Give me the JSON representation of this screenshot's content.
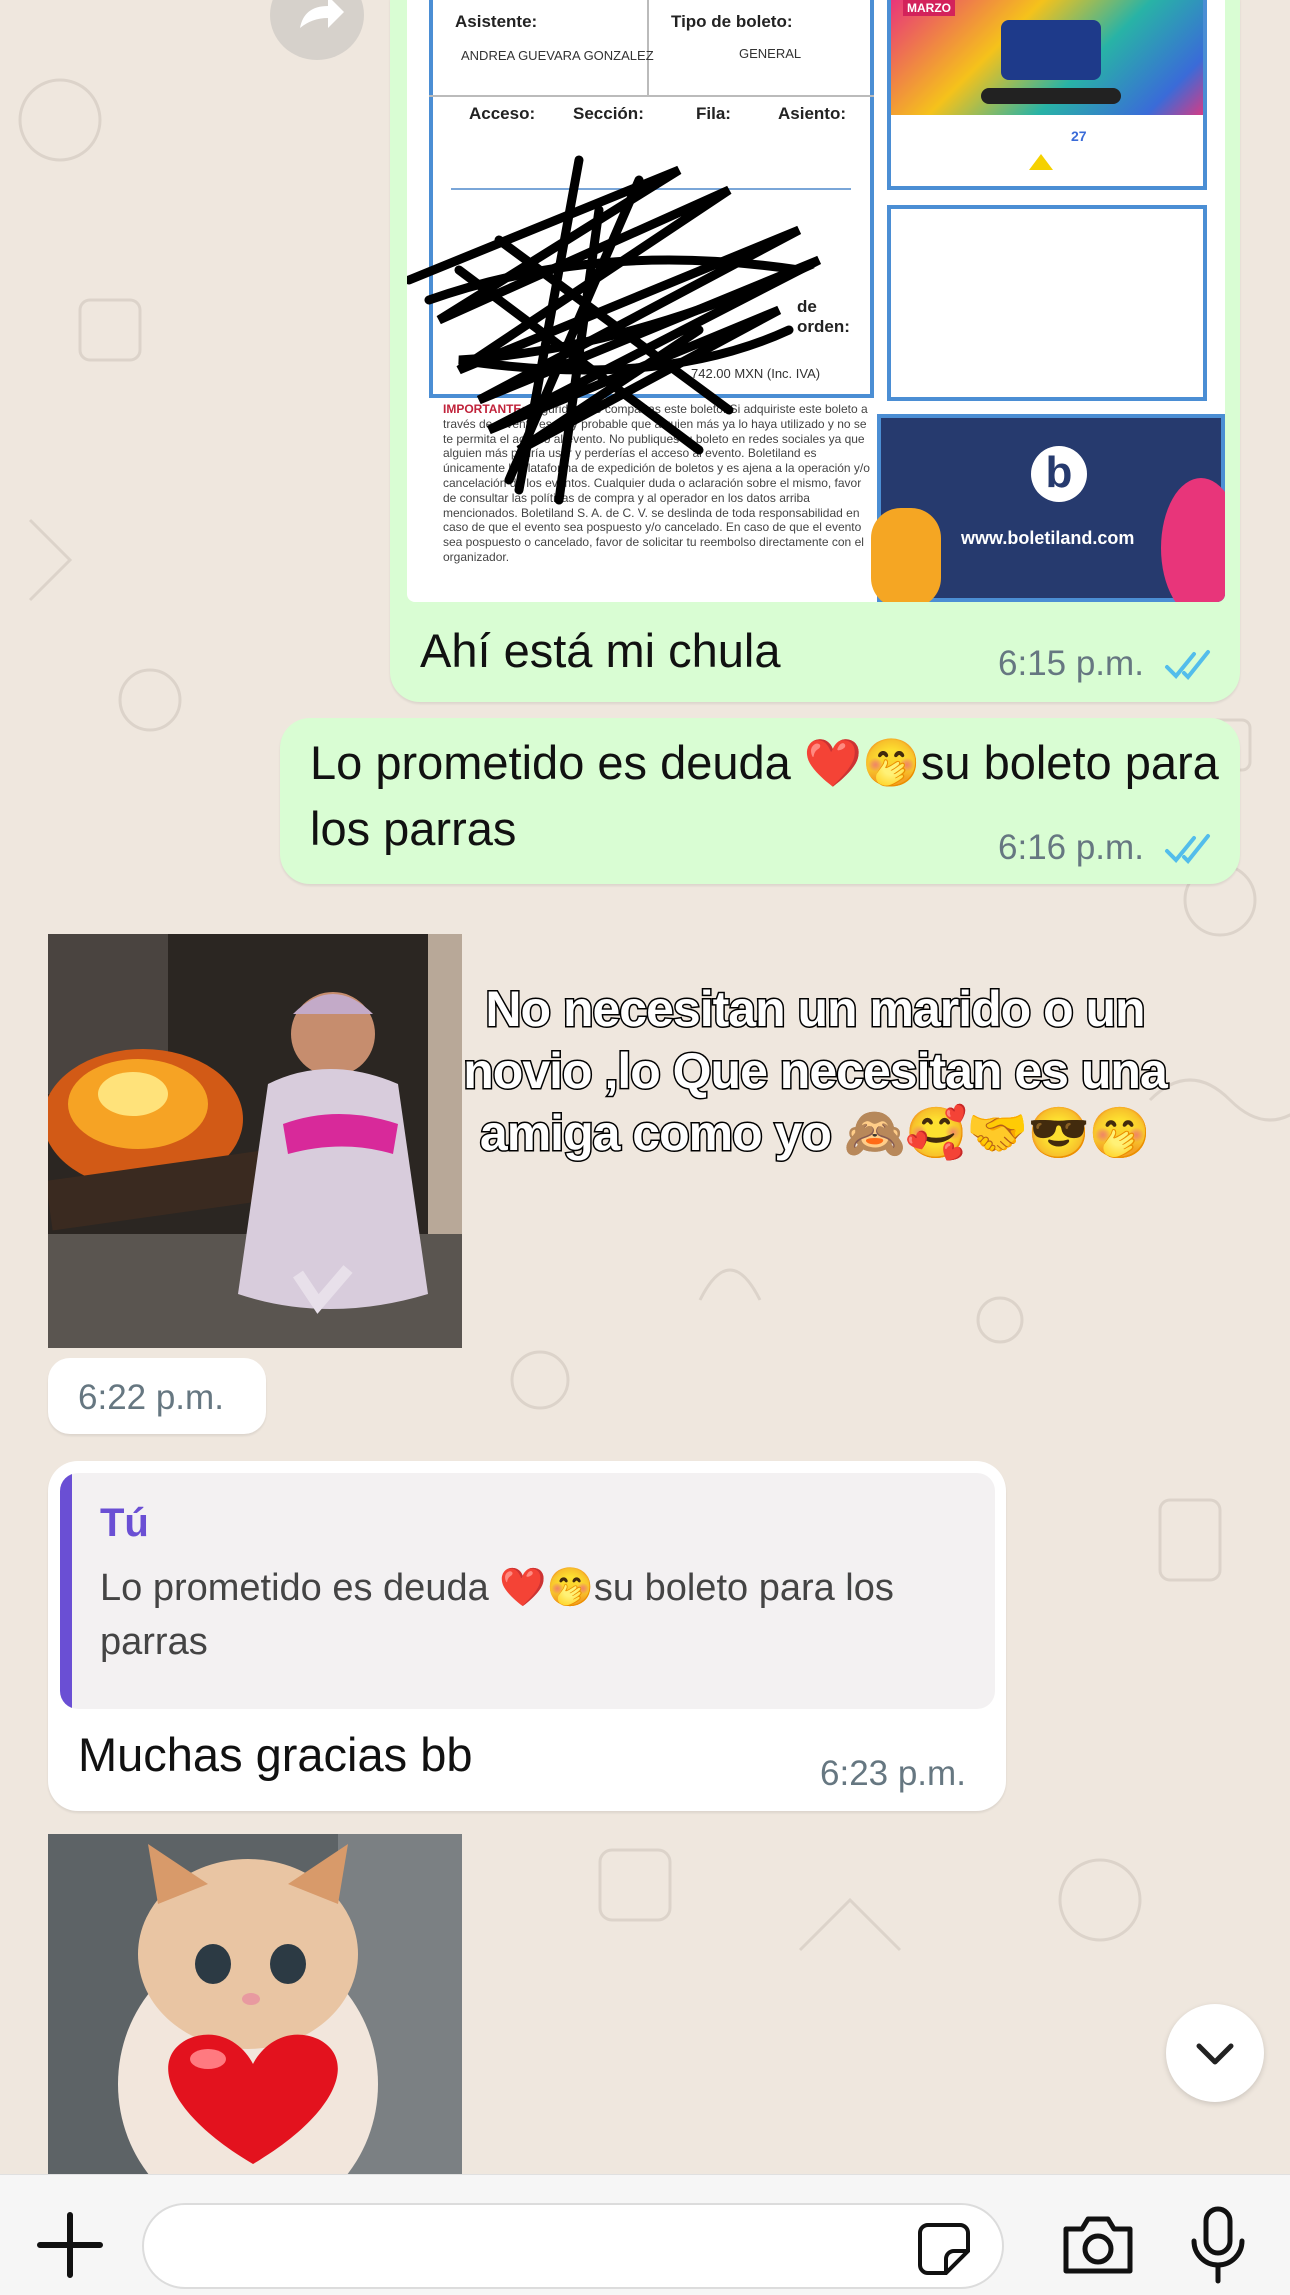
{
  "ticket": {
    "attendee_label": "Asistente:",
    "attendee_value": "ANDREA GUEVARA GONZALEZ",
    "ticket_type_label": "Tipo de boleto:",
    "ticket_type_value": "GENERAL",
    "access_label": "Acceso:",
    "section_label": "Sección:",
    "row_label": "Fila:",
    "seat_label": "Asiento:",
    "order_label": "de orden:",
    "price_text": "742.00 MXN (Inc. IVA)",
    "fine_print_lead": "IMPORTANTE:",
    "fine_print_bold": "no compartas este boleto.",
    "fine_print": "seguridad, no compartas este boleto. Si adquiriste este boleto a través de reventa es muy probable que alguien más ya lo haya utilizado y no se te permita el acceso al evento. No publiques tu boleto en redes sociales ya que alguien más podría usar y perderías el acceso al evento. Boletiland es únicamente la plataforma de expedición de boletos y es ajena a la operación y/o cancelación de los eventos. Cualquier duda o aclaración sobre el mismo, favor de consultar las políticas de compra y al operador en los datos arriba mencionados. Boletiland S. A. de C. V. se deslinda de toda responsabilidad en caso de que el evento sea pospuesto y/o cancelado. En caso de que el evento sea pospuesto o cancelado, favor de solicitar tu reembolso directamente con el organizador.",
    "brand_url": "www.boletiland.com",
    "banner_month": "MARZO",
    "banner_day": "27"
  },
  "messages": [
    {
      "id": "m1",
      "text": "Ahí está mi chula",
      "time": "6:15 p.m."
    },
    {
      "id": "m2",
      "text": "Lo prometido es deuda ❤️🤭su boleto para los parras",
      "time": "6:16 p.m."
    },
    {
      "id": "m3",
      "caption": "No necesitan un marido o un novio ,lo Que necesitan es una amiga como yo 🙈🥰🤝😎🤭",
      "time": "6:22 p.m."
    },
    {
      "id": "m4",
      "quote_author": "Tú",
      "quote_text": "Lo prometido es deuda ❤️🤭su boleto para los parras",
      "text": "Muchas gracias bb",
      "time": "6:23 p.m."
    }
  ],
  "colors": {
    "outgoing_bubble": "#d9fdd3",
    "incoming_bubble": "#ffffff",
    "read_ticks": "#53bdeb",
    "quote_accent": "#6a4fd4",
    "chat_background": "#efe7de"
  },
  "icons": [
    "forward-icon",
    "read-ticks-icon",
    "scroll-down-icon",
    "plus-icon",
    "sticker-icon",
    "camera-icon",
    "microphone-icon"
  ]
}
